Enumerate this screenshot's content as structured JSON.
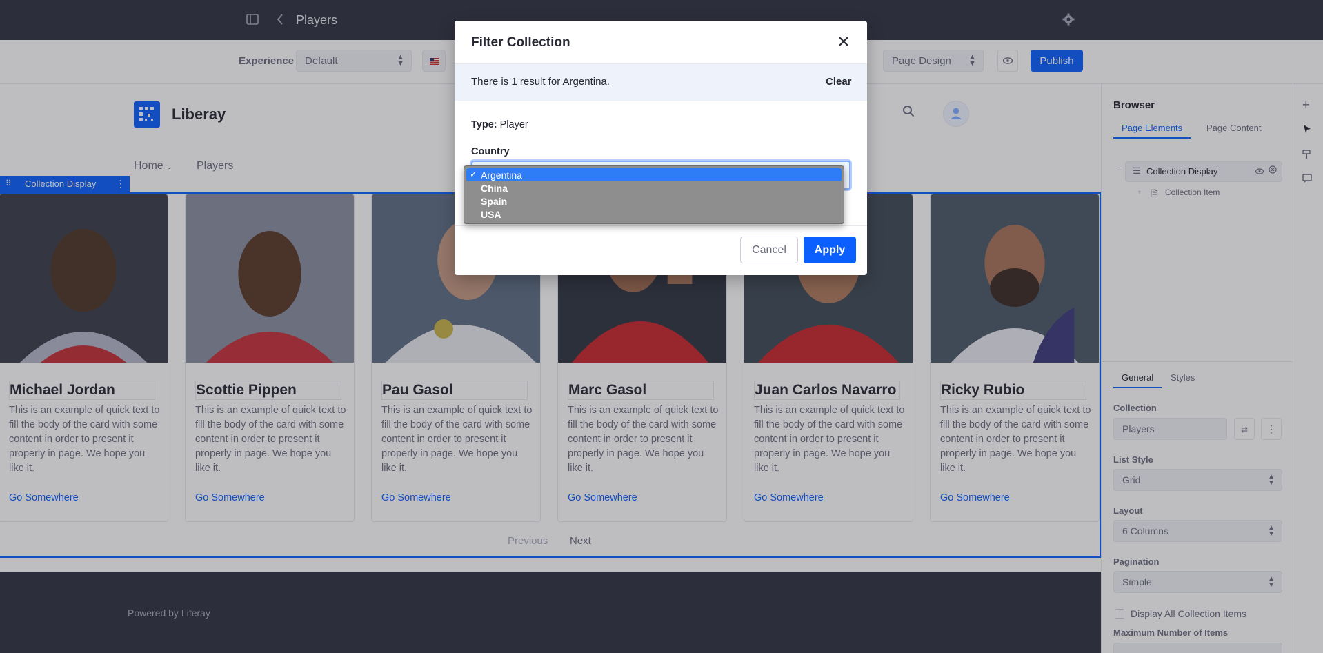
{
  "topbar": {
    "title": "Players"
  },
  "toolbar": {
    "experience_label": "Experience",
    "experience_value": "Default",
    "mode_value": "Page Design",
    "publish_label": "Publish"
  },
  "site": {
    "brand": "Liberay",
    "nav": {
      "home": "Home",
      "players": "Players"
    },
    "collection_tag": "Collection Display",
    "footer": "Powered by Liferay"
  },
  "cards": [
    {
      "name": "Michael Jordan",
      "text": "This is an example of quick text to fill the body of the card with some content in order to present it properly in page. We hope you like it.",
      "link": "Go Somewhere"
    },
    {
      "name": "Scottie Pippen",
      "text": "This is an example of quick text to fill the body of the card with some content in order to present it properly in page. We hope you like it.",
      "link": "Go Somewhere"
    },
    {
      "name": "Pau Gasol",
      "text": "This is an example of quick text to fill the body of the card with some content in order to present it properly in page. We hope you like it.",
      "link": "Go Somewhere"
    },
    {
      "name": "Marc Gasol",
      "text": "This is an example of quick text to fill the body of the card with some content in order to present it properly in page. We hope you like it.",
      "link": "Go Somewhere"
    },
    {
      "name": "Juan Carlos Navarro",
      "text": "This is an example of quick text to fill the body of the card with some content in order to present it properly in page. We hope you like it.",
      "link": "Go Somewhere"
    },
    {
      "name": "Ricky Rubio",
      "text": "This is an example of quick text to fill the body of the card with some content in order to present it properly in page. We hope you like it.",
      "link": "Go Somewhere"
    }
  ],
  "pagination": {
    "previous": "Previous",
    "next": "Next"
  },
  "sidebar": {
    "title": "Browser",
    "tabs": [
      "Page Elements",
      "Page Content"
    ],
    "tree": {
      "root": "Collection Display",
      "child": "Collection Item"
    },
    "config_tabs": [
      "General",
      "Styles"
    ],
    "collection_label": "Collection",
    "collection_value": "Players",
    "list_style_label": "List Style",
    "list_style_value": "Grid",
    "layout_label": "Layout",
    "layout_value": "6 Columns",
    "pagination_label": "Pagination",
    "pagination_value": "Simple",
    "display_all_label": "Display All Collection Items",
    "max_items_label": "Maximum Number of Items"
  },
  "modal": {
    "title": "Filter Collection",
    "result_text": "There is 1 result for Argentina.",
    "clear_label": "Clear",
    "type_label": "Type:",
    "type_value": "Player",
    "country_label": "Country",
    "country_options": [
      "Argentina",
      "China",
      "Spain",
      "USA"
    ],
    "country_selected": "Argentina",
    "cancel_label": "Cancel",
    "apply_label": "Apply"
  },
  "colors": {
    "primary": "#0b5fff",
    "topbar": "#30313f",
    "overlay": "rgba(39,40,51,0.3)"
  },
  "icons": [
    "sidebar-toggle-icon",
    "back-icon",
    "gear-icon",
    "flag-icon",
    "eye-icon",
    "search-icon",
    "user-icon",
    "close-icon",
    "plus-icon",
    "cursor-icon",
    "paint-icon",
    "comment-icon"
  ]
}
